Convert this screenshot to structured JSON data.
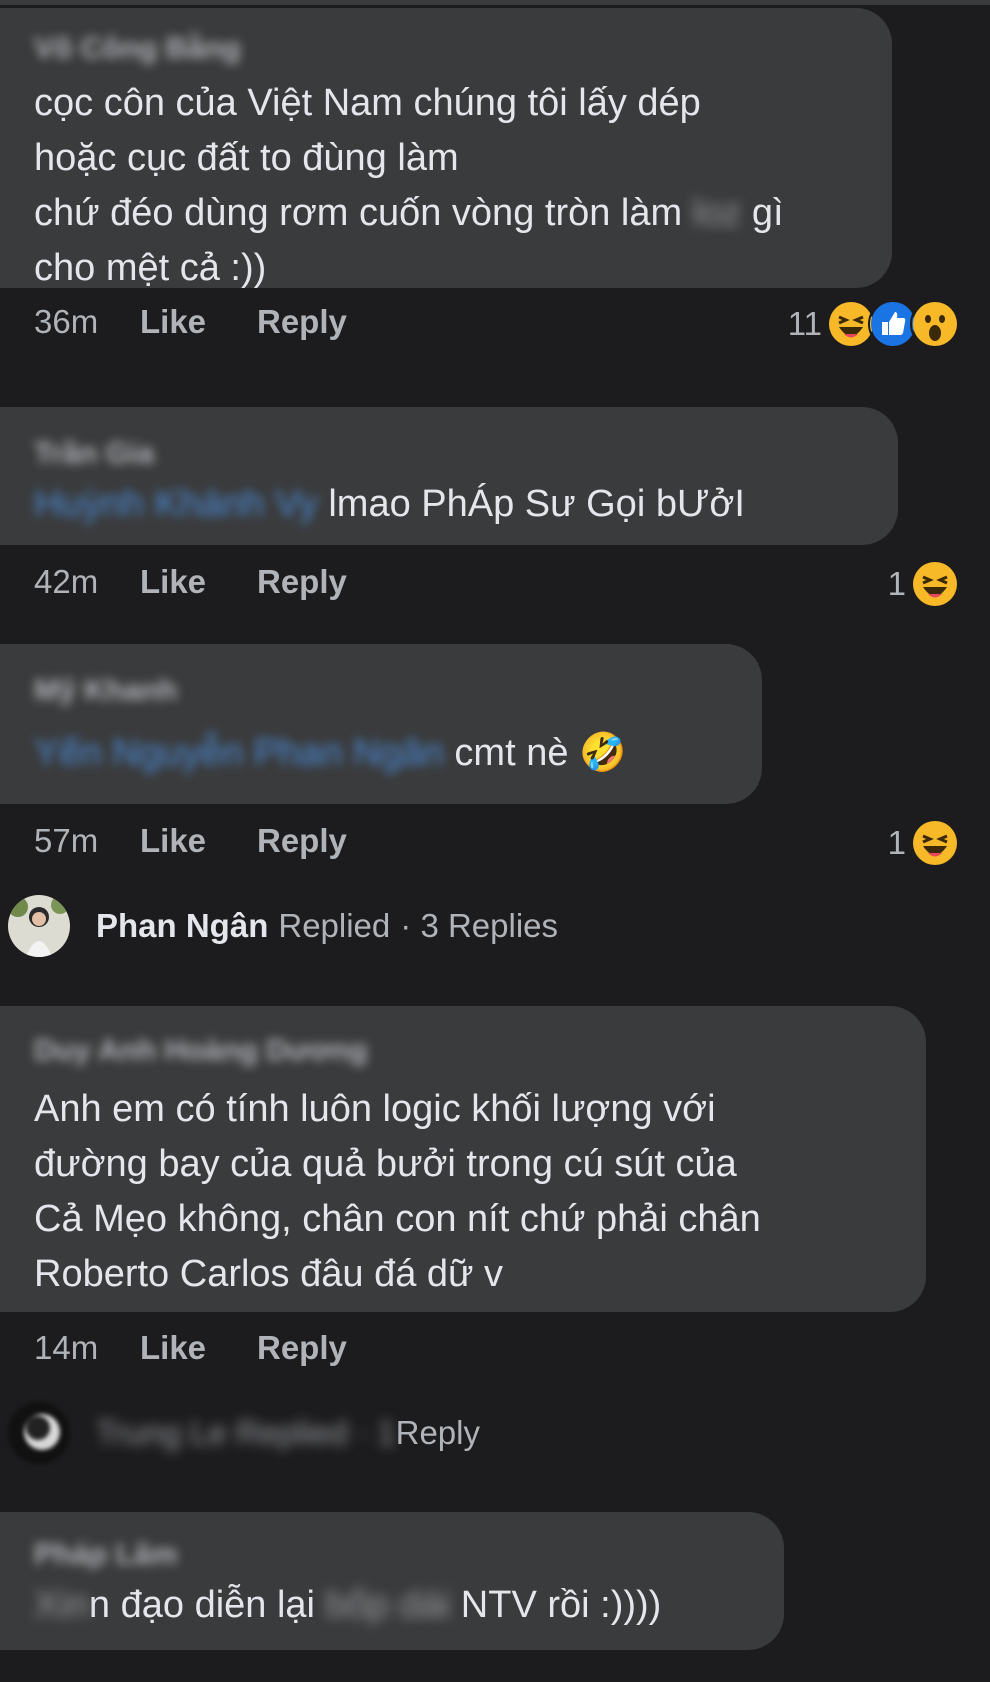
{
  "comments": [
    {
      "author": "Võ Công Bằng",
      "lines": [
        "cọc côn của Việt Nam chúng tôi lấy dép",
        "hoặc cục đất to đùng làm"
      ],
      "line3_before": "chứ đéo dùng rơm cuốn vòng tròn làm ",
      "line3_blur": "loz",
      "line3_after": " gì",
      "line4": "cho mệt cả :))",
      "time": "36m",
      "like": "Like",
      "reply": "Reply",
      "reaction_count": "11",
      "reactions": [
        "haha-emoji",
        "like-emoji",
        "wow-emoji"
      ]
    },
    {
      "author": "Trần Gia",
      "mention": "Huỳnh Khánh Vy",
      "text": "lmao PhÁp Sư  Gọi bƯởI",
      "time": "42m",
      "like": "Like",
      "reply": "Reply",
      "reaction_count": "1",
      "reactions": [
        "haha-emoji"
      ]
    },
    {
      "author": "Mỹ Khanh",
      "mention": "Yến Nguyễn Phan Ngân",
      "text": "cmt nè 🤣",
      "time": "57m",
      "like": "Like",
      "reply": "Reply",
      "reaction_count": "1",
      "reactions": [
        "haha-emoji"
      ]
    },
    {
      "author": "Duy Anh Hoàng Dương",
      "lines": [
        "Anh em có tính luôn logic khối lượng với",
        "đường bay của quả bưởi trong cú sút của",
        "Cả Mẹo không, chân con nít chứ phải chân",
        "Roberto Carlos đâu đá dữ v"
      ],
      "time": "14m",
      "like": "Like",
      "reply": "Reply"
    },
    {
      "author": "Pháp Lâm",
      "blur1": "Xin",
      "mid": "n đạo diễn lại ",
      "blur2": "bốp dái",
      "end": " NTV rồi :))))"
    }
  ],
  "threads": [
    {
      "name": "Phan Ngân",
      "replied": "Replied",
      "replies": "· 3 Replies"
    },
    {
      "blurred": "Trung Le Replied · 1",
      "visible": "Reply"
    }
  ],
  "colors": {
    "background": "#1c1c1e",
    "bubble": "#3a3b3c",
    "meta": "#b0b3b8",
    "mention": "#4b8bd8"
  }
}
